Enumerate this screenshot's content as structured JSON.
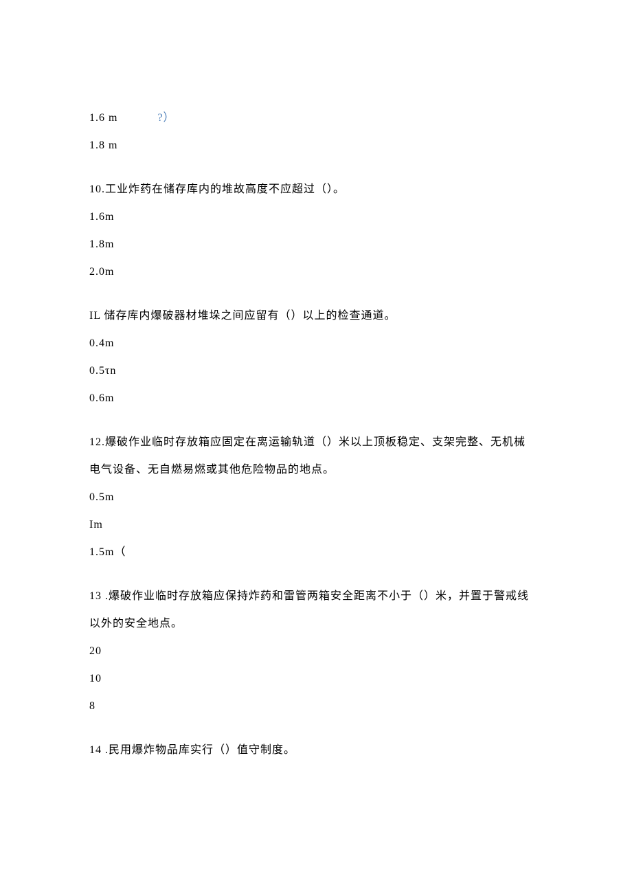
{
  "prev_tail": {
    "opt1_a": "1.6 m",
    "opt1_b": "?）",
    "opt2": "1.8 m"
  },
  "q10": {
    "text": "10.工业炸药在储存库内的堆故高度不应超过（）。",
    "opts": [
      "1.6m",
      "1.8m",
      "2.0m"
    ]
  },
  "q11": {
    "text": "IL 储存库内爆破器材堆垛之间应留有（）以上的检查通道。",
    "opts": [
      "0.4m",
      "0.5τn",
      "0.6m"
    ]
  },
  "q12": {
    "text_l1": "12.爆破作业临时存放箱应固定在离运输轨道（）米以上顶板稳定、支架完整、无机械",
    "text_l2": "电气设备、无自燃易燃或其他危险物品的地点。",
    "opts": [
      "0.5m",
      "Im",
      "1.5m（"
    ]
  },
  "q13": {
    "text_l1": "13 .爆破作业临时存放箱应保持炸药和雷管两箱安全距离不小于（）米，并置于警戒线",
    "text_l2": "以外的安全地点。",
    "opts": [
      "20",
      "10",
      "8"
    ]
  },
  "q14": {
    "text": "14 .民用爆炸物品库实行（）值守制度。"
  }
}
